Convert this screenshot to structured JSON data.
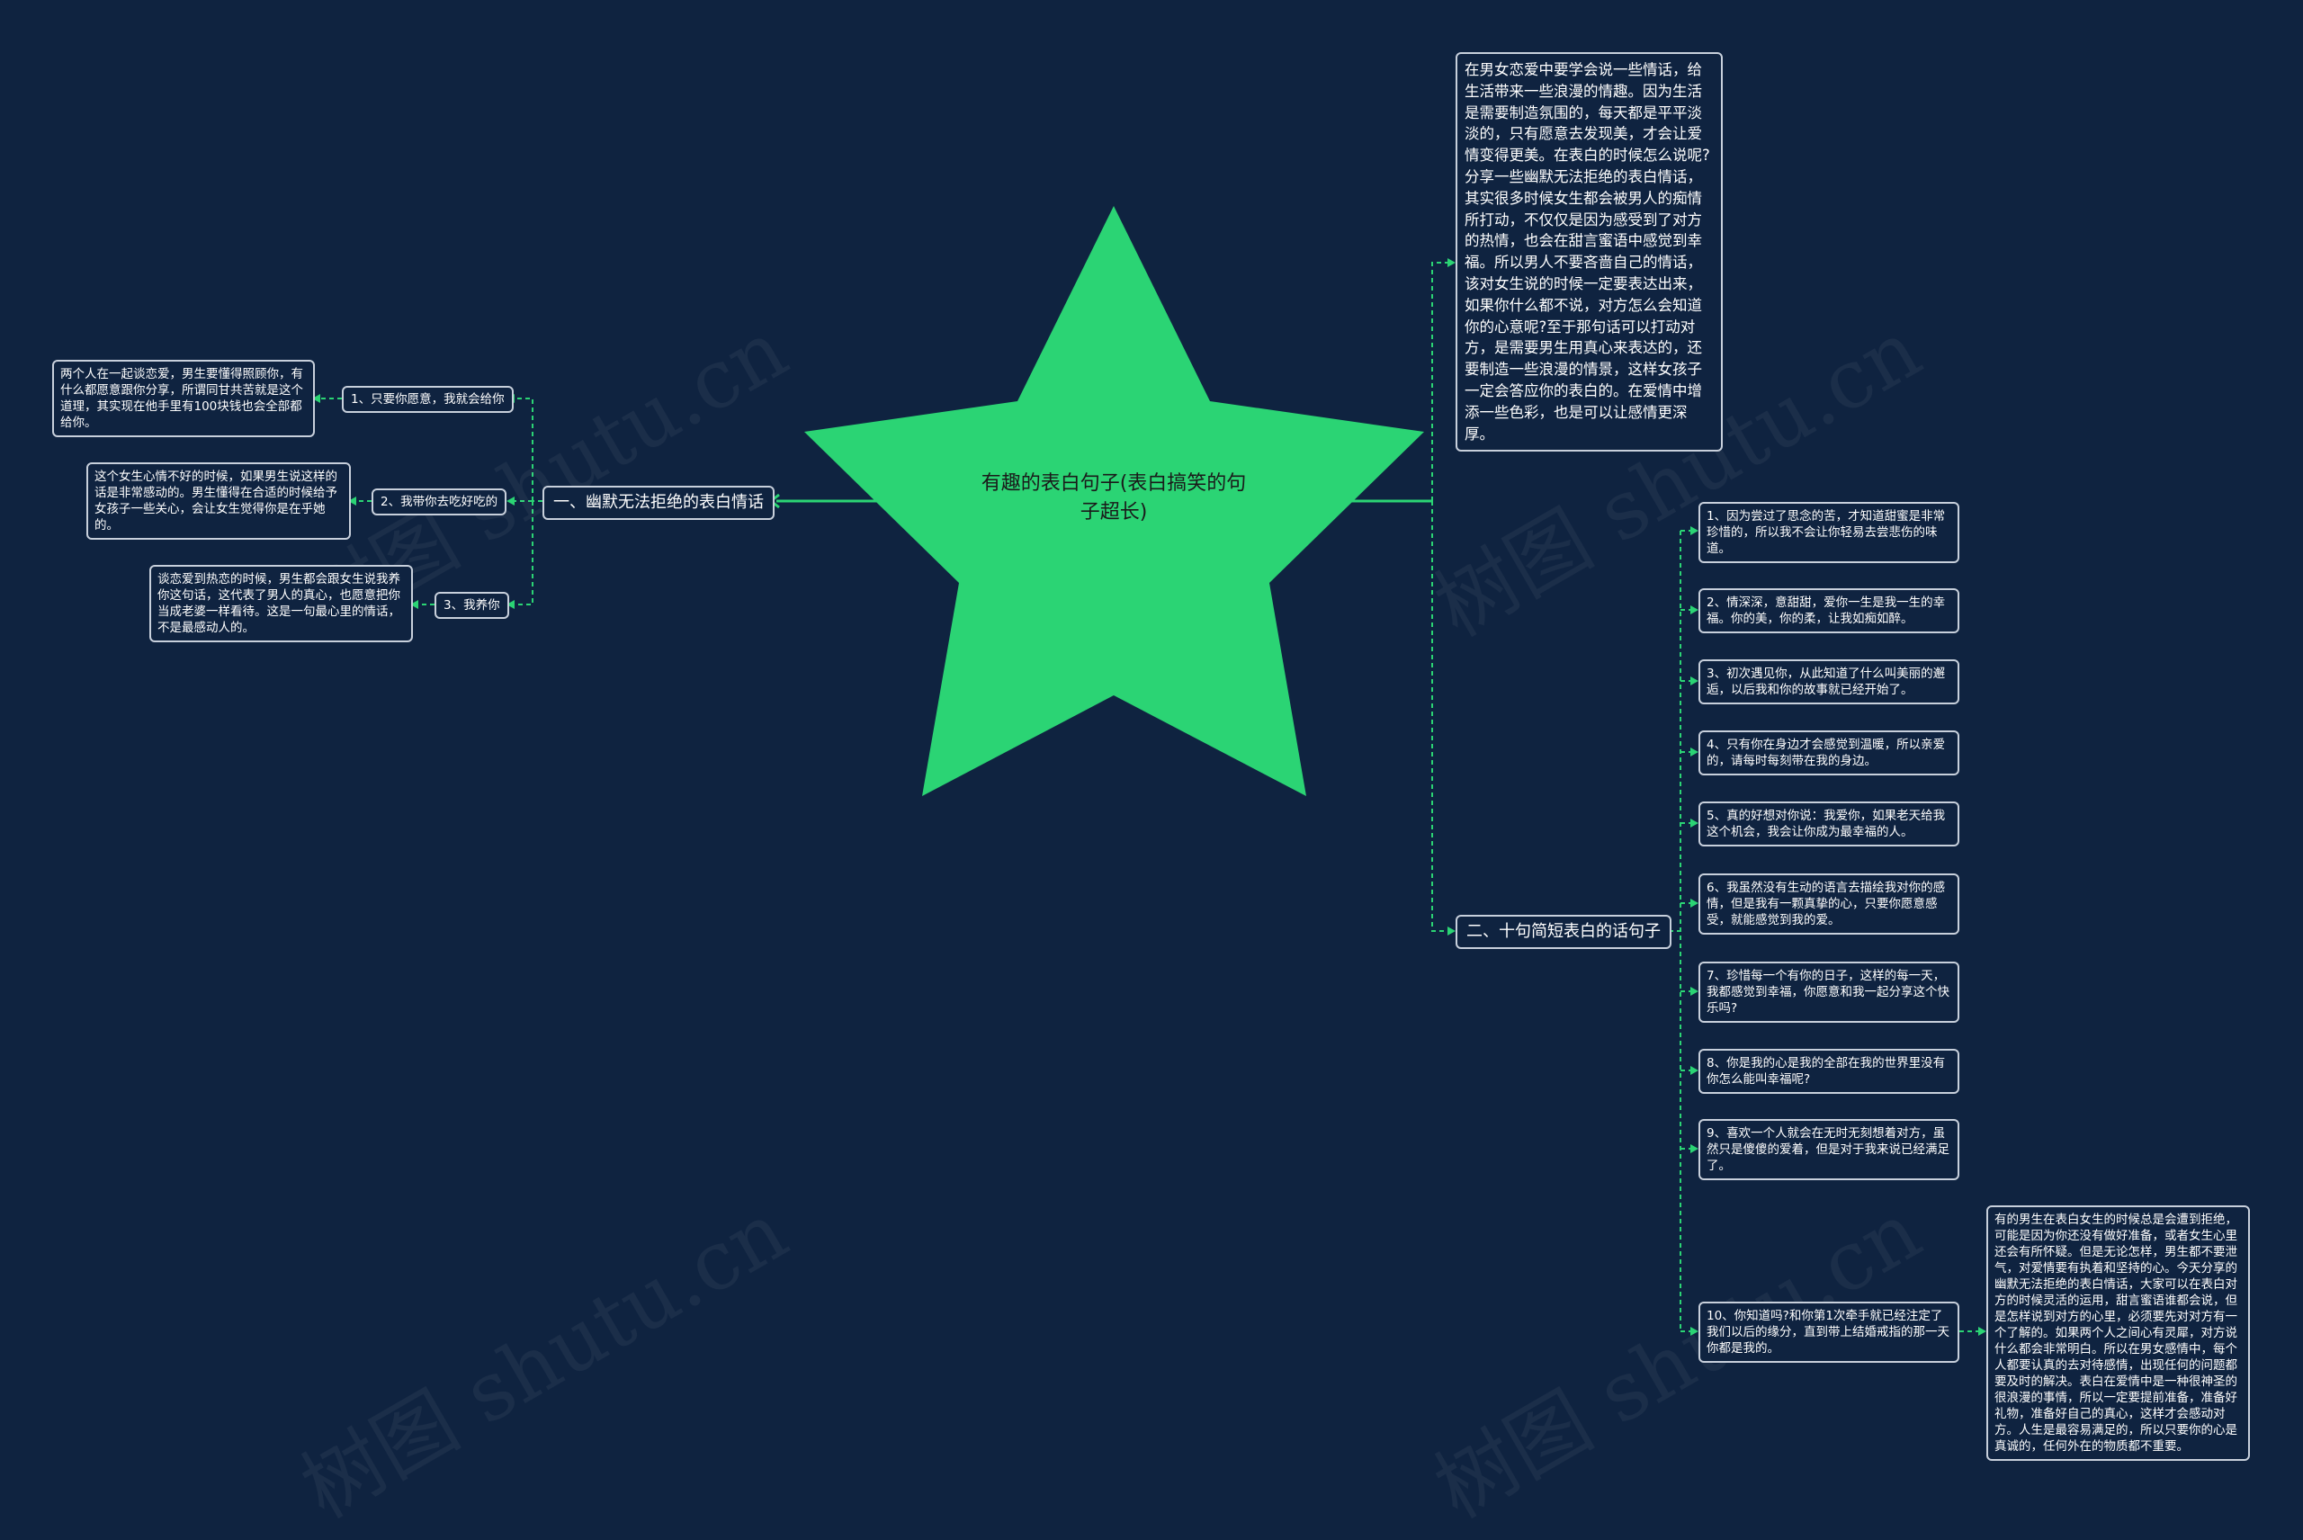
{
  "colors": {
    "background": "#0f2340",
    "star": "#2bd474",
    "connector": "#2bd474",
    "node_border": "#c8d0dc",
    "node_text": "#ffffff",
    "root_text": "#1a1a1a"
  },
  "watermark": "树图 shutu.cn",
  "root": {
    "title": "有趣的表白句子(表白搞笑的句子超长)"
  },
  "left_branch": {
    "label": "一、幽默无法拒绝的表白情话",
    "items": [
      {
        "label": "1、只要你愿意，我就会给你",
        "detail": "两个人在一起谈恋爱，男生要懂得照顾你，有什么都愿意跟你分享，所谓同甘共苦就是这个道理，其实现在他手里有100块钱也会全部都给你。"
      },
      {
        "label": "2、我带你去吃好吃的",
        "detail": "这个女生心情不好的时候，如果男生说这样的话是非常感动的。男生懂得在合适的时候给予女孩子一些关心，会让女生觉得你是在乎她的。"
      },
      {
        "label": "3、我养你",
        "detail": "谈恋爱到热恋的时候，男生都会跟女生说我养你这句话，这代表了男人的真心，也愿意把你当成老婆一样看待。这是一句最心里的情话，不是最感动人的。"
      }
    ]
  },
  "right_intro": "在男女恋爱中要学会说一些情话，给生活带来一些浪漫的情趣。因为生活是需要制造氛围的，每天都是平平淡淡的，只有愿意去发现美，才会让爱情变得更美。在表白的时候怎么说呢?分享一些幽默无法拒绝的表白情话，其实很多时候女生都会被男人的痴情所打动，不仅仅是因为感受到了对方的热情，也会在甜言蜜语中感觉到幸福。所以男人不要吝啬自己的情话，该对女生说的时候一定要表达出来，如果你什么都不说，对方怎么会知道你的心意呢?至于那句话可以打动对方，是需要男生用真心来表达的，还要制造一些浪漫的情景，这样女孩子一定会答应你的表白的。在爱情中增添一些色彩，也是可以让感情更深厚。",
  "right_branch": {
    "label": "二、十句简短表白的话句子",
    "items": [
      "1、因为尝过了思念的苦，才知道甜蜜是非常珍惜的，所以我不会让你轻易去尝悲伤的味道。",
      "2、情深深，意甜甜，爱你一生是我一生的幸福。你的美，你的柔，让我如痴如醉。",
      "3、初次遇见你，从此知道了什么叫美丽的邂逅，以后我和你的故事就已经开始了。",
      "4、只有你在身边才会感觉到温暖，所以亲爱的，请每时每刻带在我的身边。",
      "5、真的好想对你说：我爱你，如果老天给我这个机会，我会让你成为最幸福的人。",
      "6、我虽然没有生动的语言去描绘我对你的感情，但是我有一颗真挚的心，只要你愿意感受，就能感觉到我的爱。",
      "7、珍惜每一个有你的日子，这样的每一天，我都感觉到幸福，你愿意和我一起分享这个快乐吗?",
      "8、你是我的心是我的全部在我的世界里没有你怎么能叫幸福呢?",
      "9、喜欢一个人就会在无时无刻想着对方，虽然只是傻傻的爱着，但是对于我来说已经满足了。",
      "10、你知道吗?和你第1次牵手就已经注定了我们以后的缘分，直到带上结婚戒指的那一天你都是我的。"
    ],
    "item10_detail": "有的男生在表白女生的时候总是会遭到拒绝，可能是因为你还没有做好准备，或者女生心里还会有所怀疑。但是无论怎样，男生都不要泄气，对爱情要有执着和坚持的心。今天分享的幽默无法拒绝的表白情话，大家可以在表白对方的时候灵活的运用，甜言蜜语谁都会说，但是怎样说到对方的心里，必须要先对对方有一个了解的。如果两个人之间心有灵犀，对方说什么都会非常明白。所以在男女感情中，每个人都要认真的去对待感情，出现任何的问题都要及时的解决。表白在爱情中是一种很神圣的很浪漫的事情，所以一定要提前准备，准备好礼物，准备好自己的真心，这样才会感动对方。人生是最容易满足的，所以只要你的心是真诚的，任何外在的物质都不重要。"
  }
}
